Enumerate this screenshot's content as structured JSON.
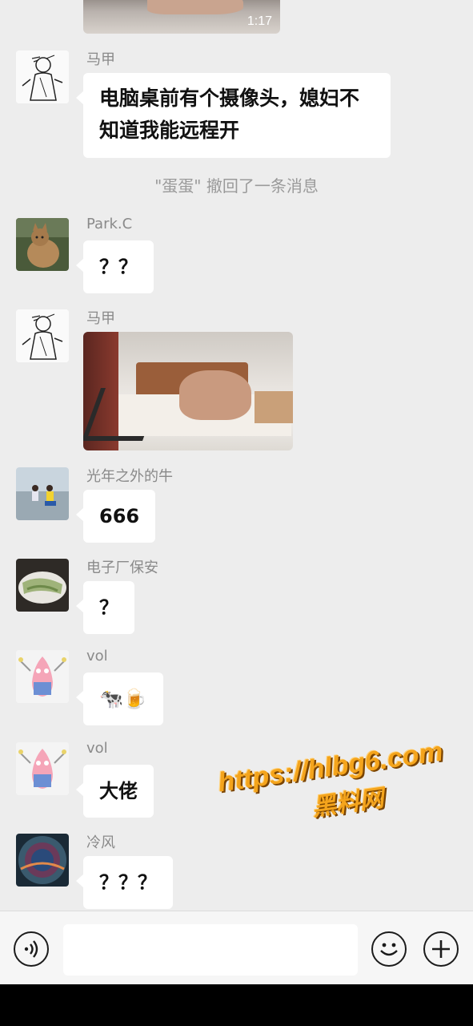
{
  "top_video": {
    "duration": "1:17"
  },
  "messages": [
    {
      "sender": "马甲",
      "text": "电脑桌前有个摄像头，媳妇不知道我能远程开"
    },
    {
      "sender": "Park.C",
      "text": "？？"
    },
    {
      "sender": "马甲"
    },
    {
      "sender": "光年之外的牛",
      "text": "666"
    },
    {
      "sender": "电子厂保安",
      "text": "？"
    },
    {
      "sender": "vol",
      "text": "🐄🍺"
    },
    {
      "sender": "vol",
      "text": "大佬"
    },
    {
      "sender": "冷风",
      "text": "？？？"
    }
  ],
  "recall_notice": "\"蛋蛋\" 撤回了一条消息",
  "watermark": {
    "url": "https://hlbg6.com",
    "name": "黑料网"
  },
  "icons": {
    "voice": "voice-input-icon",
    "emoji": "emoji-icon",
    "plus": "add-more-icon"
  },
  "colors": {
    "background": "#ededed",
    "bubble": "#ffffff",
    "watermark": "#f4a41c"
  }
}
